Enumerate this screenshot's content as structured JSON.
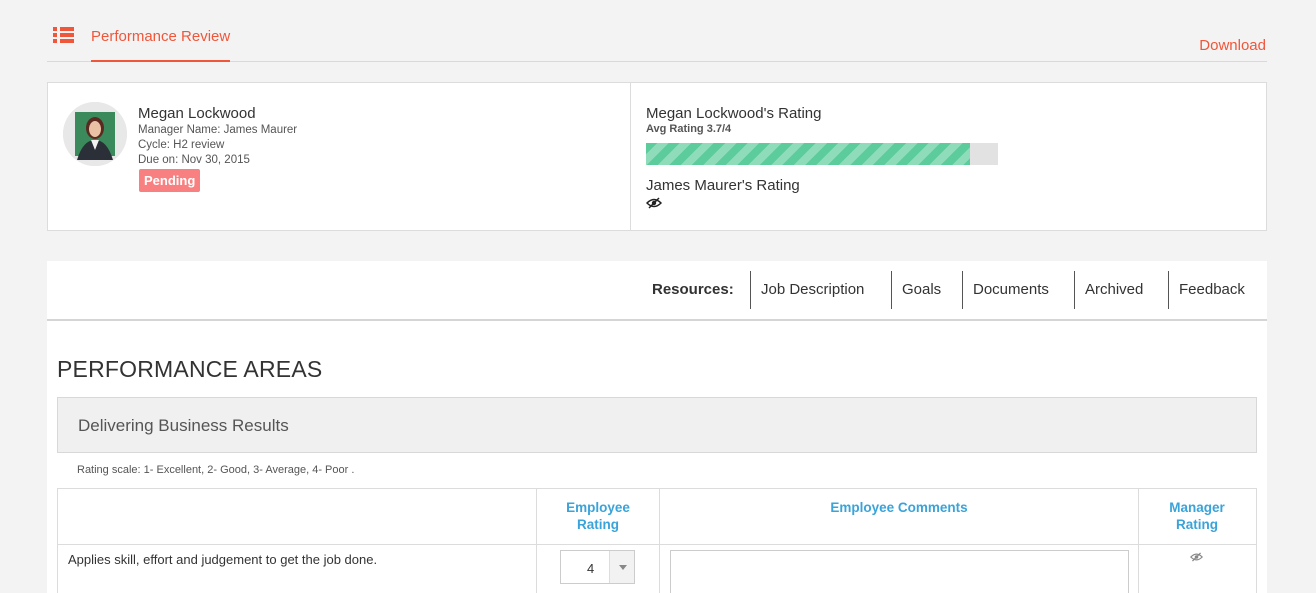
{
  "header": {
    "tab_label": "Performance Review",
    "download_label": "Download"
  },
  "profile": {
    "name": "Megan Lockwood",
    "manager": "Manager Name: James Maurer",
    "cycle": "Cycle: H2 review",
    "due": "Due on: Nov 30, 2015",
    "status": "Pending"
  },
  "ratings": {
    "employee_title": "Megan Lockwood's Rating",
    "avg_label": "Avg Rating 3.7/4",
    "avg_value": 3.7,
    "avg_max": 4,
    "manager_title": "James Maurer's Rating"
  },
  "resources": {
    "label": "Resources:",
    "links": [
      "Job Description",
      "Goals",
      "Documents",
      "Archived",
      "Feedback"
    ]
  },
  "performance": {
    "section_title": "PERFORMANCE AREAS",
    "area_title": "Delivering Business Results",
    "scale_note": "Rating scale: 1- Excellent, 2- Good, 3- Average, 4- Poor .",
    "columns": {
      "employee_rating": "Employee Rating",
      "employee_comments": "Employee Comments",
      "manager_rating": "Manager Rating"
    },
    "rows": [
      {
        "question": "Applies skill, effort and judgement to get the job done.",
        "employee_rating": "4",
        "comment": ""
      }
    ]
  },
  "colors": {
    "accent": "#f0563a",
    "link_blue": "#3aa3d9",
    "progress_green": "#5dcc9c",
    "badge": "#f88080"
  },
  "icons": [
    "menu-list-icon",
    "eye-slash-icon",
    "chevron-down-icon"
  ]
}
